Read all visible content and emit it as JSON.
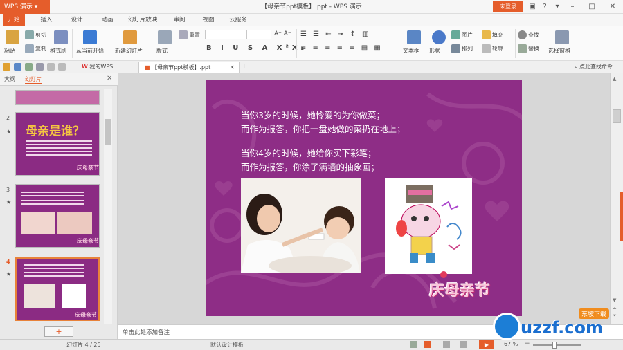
{
  "app": {
    "menu_button": "WPS 演示",
    "document_title": "【母亲节ppt模板】.ppt - WPS 演示",
    "login_label": "未登录"
  },
  "menu_tabs": [
    "开始",
    "插入",
    "设计",
    "动画",
    "幻灯片放映",
    "审阅",
    "视图",
    "云服务"
  ],
  "ribbon": {
    "paste": "粘贴",
    "cut": "剪切",
    "copy": "复制",
    "format_painter": "格式刷",
    "from_current": "从当前开始",
    "new_slide": "新建幻灯片",
    "layout": "版式",
    "reset": "重置",
    "text_box": "文本框",
    "shape": "形状",
    "arrange": "排列",
    "image": "图片",
    "fill": "填充",
    "outline": "轮廓",
    "find": "查找",
    "replace": "替换",
    "select_pane": "选择窗格"
  },
  "qbar": {
    "my_wps": "我的WPS",
    "doc_tab": "【母亲节ppt模板】.ppt",
    "search_placeholder": "点此查找命令"
  },
  "left_pane": {
    "tab_outline": "大纲",
    "tab_slides": "幻灯片",
    "slide_numbers": [
      "2",
      "3",
      "4"
    ],
    "slide2_title": "母亲是谁？",
    "logo_text": "庆母亲节"
  },
  "slide": {
    "lines": [
      "当你3岁的时候，她怜爱的为你做菜；",
      "而作为报答，你把一盘她做的菜扔在地上；",
      "当你4岁的时候，她给你买下彩笔；",
      "而作为报答，你涂了满墙的抽象画；"
    ],
    "logo_text": "庆母亲节"
  },
  "notes": {
    "placeholder": "单击此处添加备注"
  },
  "status": {
    "slide_counter": "幻灯片 4 / 25",
    "template": "默认设计模板",
    "zoom": "67 %"
  },
  "watermark": {
    "site": "uzzf.com",
    "tag": "东坡下载"
  }
}
